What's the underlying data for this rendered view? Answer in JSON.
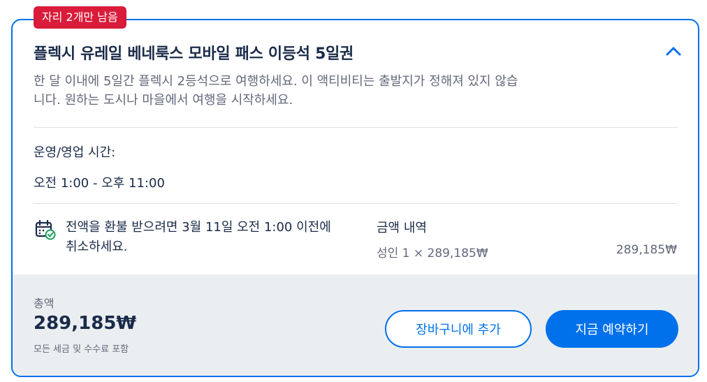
{
  "badge": {
    "text": "자리 2개만 남음",
    "color": "#d91c3a"
  },
  "option": {
    "title": "플렉시 유레일 베네룩스 모바일 패스 이등석 5일권",
    "description": "한 달 이내에 5일간 플렉시 2등석으로 여행하세요. 이 액티비티는 출발지가 정해져 있지 않습니다. 원하는 도시나 마을에서 여행을 시작하세요.",
    "collapse_icon": "chevron-up-icon"
  },
  "hours": {
    "label": "운영/영업 시간:",
    "value": "오전 1:00 - 오후 11:00"
  },
  "cancellation": {
    "icon": "calendar-check-icon",
    "text": "전액을 환불 받으려면 3월 11일 오전 1:00 이전에 취소하세요."
  },
  "price_breakdown": {
    "heading": "금액 내역",
    "line_label": "성인 1 × 289,185₩",
    "line_amount": "289,185₩"
  },
  "footer": {
    "total_label": "총액",
    "total_amount": "289,185₩",
    "total_note": "모든 세금 및 수수료 포함",
    "cart_button": "장바구니에 추가",
    "book_button": "지금 예약하기"
  },
  "colors": {
    "accent": "#0071eb",
    "text": "#1a2b49",
    "muted": "#63687a",
    "footer_bg": "#ebeef1",
    "check": "#1a9e5a"
  }
}
